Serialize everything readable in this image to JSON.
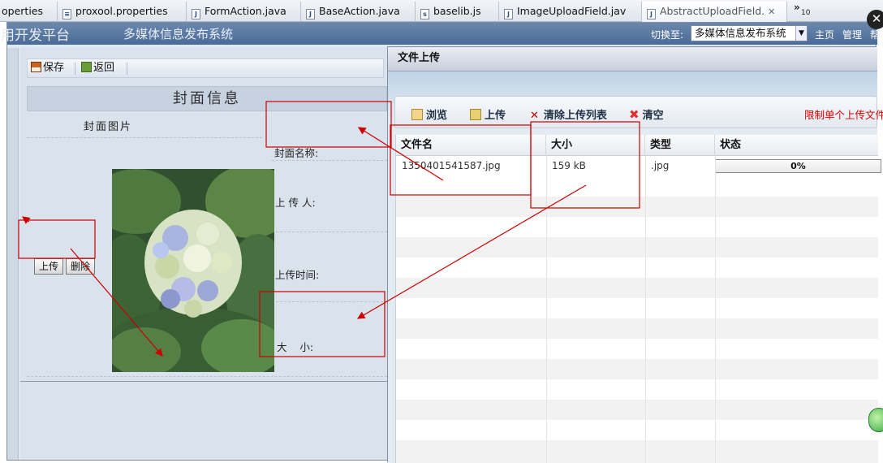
{
  "editor_tabs": [
    {
      "label": "operties",
      "icon": "none"
    },
    {
      "label": "proxool.properties",
      "icon": "properties-file-icon"
    },
    {
      "label": "FormAction.java",
      "icon": "java-file-icon"
    },
    {
      "label": "BaseAction.java",
      "icon": "java-file-icon"
    },
    {
      "label": "baselib.js",
      "icon": "js-file-icon"
    },
    {
      "label": "ImageUploadField.jav",
      "icon": "java-file-icon"
    },
    {
      "label": "AbstractUploadField.",
      "icon": "java-file-icon",
      "active": true
    }
  ],
  "tab_close_glyph": "✕",
  "tab_overflow": {
    "chevron": "»",
    "count": "10"
  },
  "app": {
    "title": "用开发平台",
    "subtitle": "多媒体信息发布系统",
    "switch_label": "切换至:",
    "switch_value": "多媒体信息发布系统",
    "nav": [
      "主页",
      "管理",
      "帮"
    ]
  },
  "left_panel": {
    "toolbar": {
      "save": "保存",
      "back": "返回"
    },
    "form_header": "封面信息",
    "cover_image_label": "封面图片",
    "upload_button": "上传",
    "delete_button": "删除",
    "fields": {
      "cover_name": "封面名称:",
      "uploader": "上 传 人:",
      "upload_time": "上传时间:",
      "size": "大    小:"
    }
  },
  "upload_dialog": {
    "title": "文件上传",
    "toolbar": {
      "browse": "浏览",
      "upload": "上传",
      "clear_list": "清除上传列表",
      "clear": "清空",
      "limit_note": "限制单个上传文件"
    },
    "columns": [
      "文件名",
      "大小",
      "类型",
      "状态"
    ],
    "rows": [
      {
        "name": "1350401541587.jpg",
        "size": "159 kB",
        "type": ".jpg",
        "status": "0%",
        "progress": 0
      }
    ]
  },
  "colors": {
    "annotation": "#cc0000",
    "header_bar": "#5a7aa3",
    "limit_text": "#d40000"
  }
}
